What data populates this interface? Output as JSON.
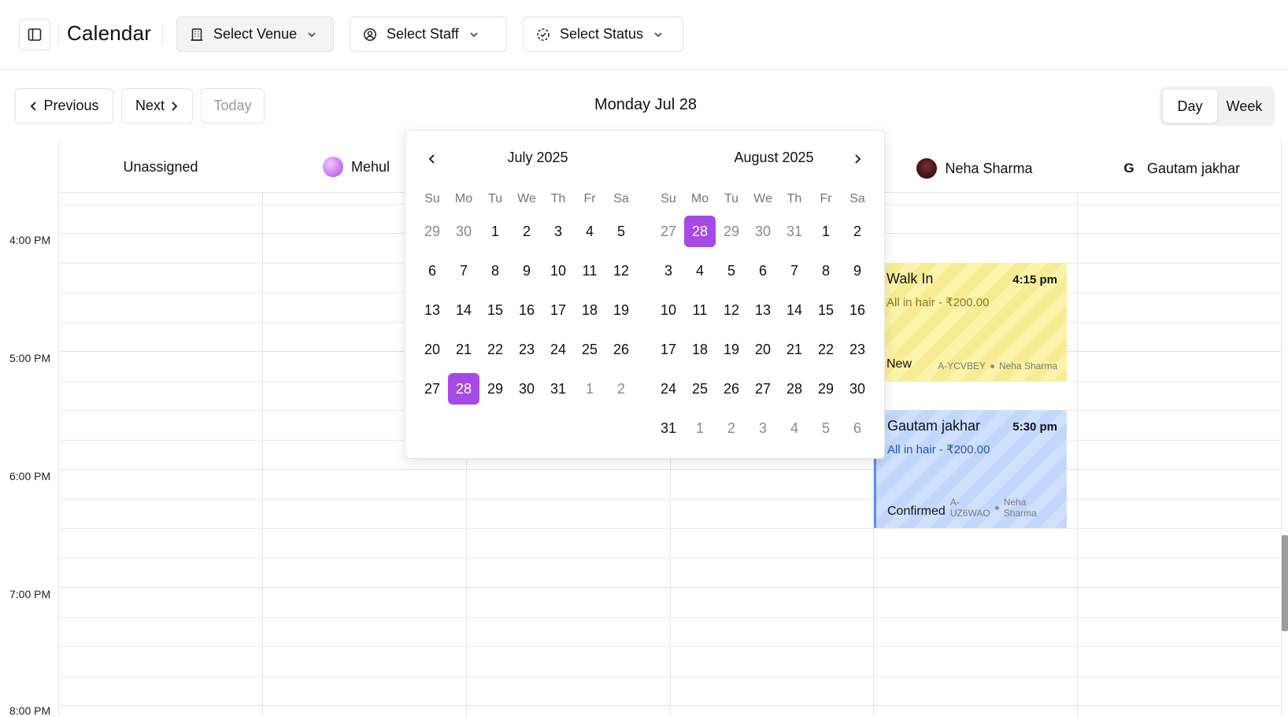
{
  "header": {
    "title": "Calendar",
    "filters": {
      "venue": "Select Venue",
      "staff": "Select Staff",
      "status": "Select Status"
    }
  },
  "nav": {
    "previous": "Previous",
    "next": "Next",
    "today": "Today",
    "current_date": "Monday Jul 28",
    "views": [
      "Day",
      "Week"
    ],
    "selected_view": "Day"
  },
  "columns": [
    {
      "name": "Unassigned",
      "avatar": "none"
    },
    {
      "name": "Mehul",
      "avatar": "gradient"
    },
    {
      "name": "Neha Sharma",
      "avatar": "photo"
    },
    {
      "name": "Gautam jakhar",
      "avatar": "letter",
      "initial": "G"
    }
  ],
  "time_labels": [
    "4:00 PM",
    "5:00 PM",
    "6:00 PM",
    "7:00 PM",
    "8:00 PM"
  ],
  "events": [
    {
      "client": "Walk In",
      "time": "4:15 pm",
      "service": "All in hair - ₹200.00",
      "status": "New",
      "code": "A-YCVBEY",
      "staff": "Neha Sharma",
      "color": "#fbf3a8"
    },
    {
      "client": "Gautam jakhar",
      "time": "5:30 pm",
      "service": "All in hair - ₹200.00",
      "status": "Confirmed",
      "code_line1": "A-",
      "code_line2": "UZ6WAO",
      "staff_line1": "Neha",
      "staff_line2": "Sharma",
      "color": "#cfe0ff"
    }
  ],
  "datepicker": {
    "accent": "#a64ae6",
    "weekdays": [
      "Su",
      "Mo",
      "Tu",
      "We",
      "Th",
      "Fr",
      "Sa"
    ],
    "months": [
      {
        "title": "July 2025",
        "weeks": [
          [
            "29",
            "30",
            "1",
            "2",
            "3",
            "4",
            "5"
          ],
          [
            "6",
            "7",
            "8",
            "9",
            "10",
            "11",
            "12"
          ],
          [
            "13",
            "14",
            "15",
            "16",
            "17",
            "18",
            "19"
          ],
          [
            "20",
            "21",
            "22",
            "23",
            "24",
            "25",
            "26"
          ],
          [
            "27",
            "28",
            "29",
            "30",
            "31",
            "1",
            "2"
          ]
        ],
        "outside": [
          [
            0,
            0
          ],
          [
            0,
            1
          ],
          [
            4,
            5
          ],
          [
            4,
            6
          ]
        ],
        "selected": [
          4,
          1
        ]
      },
      {
        "title": "August 2025",
        "weeks": [
          [
            "27",
            "28",
            "29",
            "30",
            "31",
            "1",
            "2"
          ],
          [
            "3",
            "4",
            "5",
            "6",
            "7",
            "8",
            "9"
          ],
          [
            "10",
            "11",
            "12",
            "13",
            "14",
            "15",
            "16"
          ],
          [
            "17",
            "18",
            "19",
            "20",
            "21",
            "22",
            "23"
          ],
          [
            "24",
            "25",
            "26",
            "27",
            "28",
            "29",
            "30"
          ],
          [
            "31",
            "1",
            "2",
            "3",
            "4",
            "5",
            "6"
          ]
        ],
        "outside": [
          [
            0,
            0
          ],
          [
            0,
            2
          ],
          [
            0,
            3
          ],
          [
            0,
            4
          ],
          [
            5,
            1
          ],
          [
            5,
            2
          ],
          [
            5,
            3
          ],
          [
            5,
            4
          ],
          [
            5,
            5
          ],
          [
            5,
            6
          ]
        ],
        "selected": [
          0,
          1
        ]
      }
    ]
  },
  "icons": {
    "sidebar": "sidebar-toggle-icon",
    "venue": "building-icon",
    "staff": "user-circle-icon",
    "status": "status-dashed-circle-icon",
    "chevron": "chevron-down-icon",
    "prev": "chevron-left-icon",
    "next": "chevron-right-icon"
  }
}
